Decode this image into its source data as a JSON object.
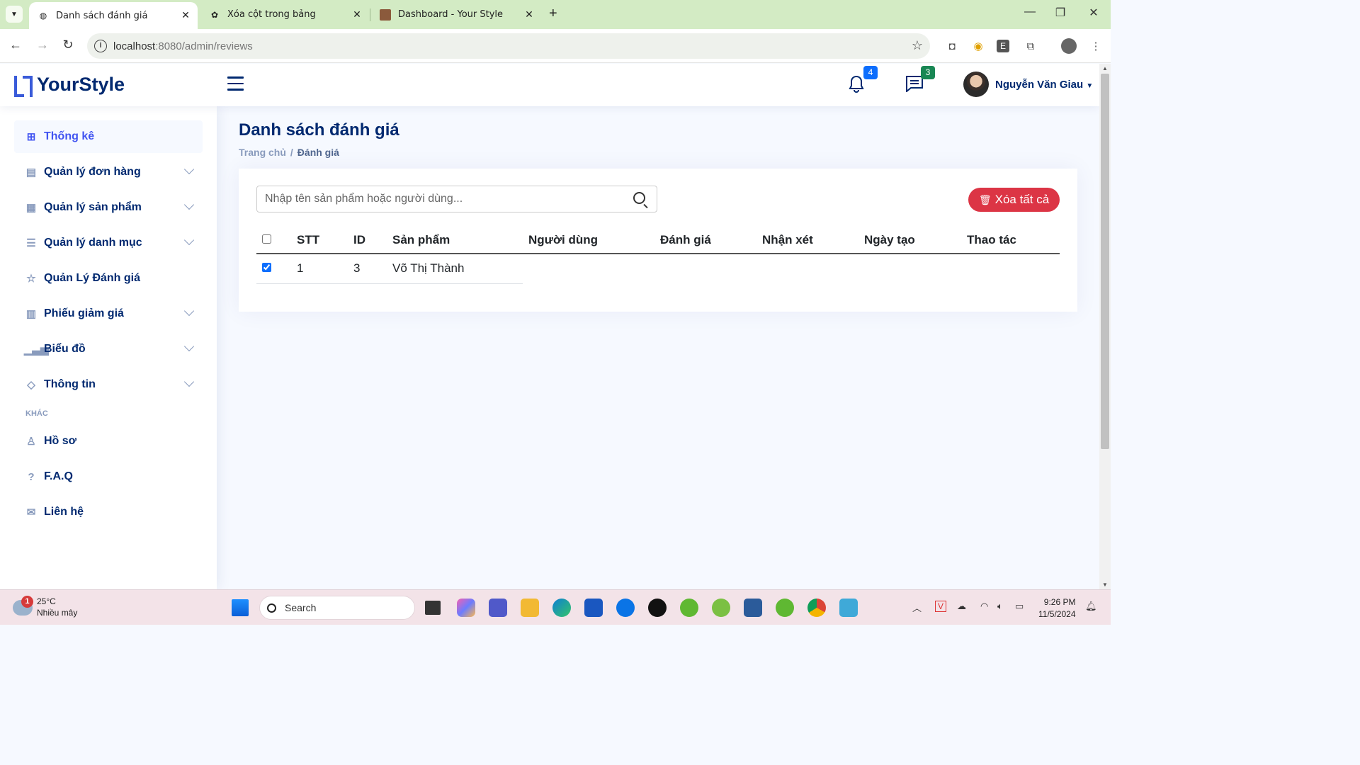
{
  "browser": {
    "tabs": [
      {
        "title": "Danh sách đánh giá",
        "active": true,
        "favicon": "globe-icon"
      },
      {
        "title": "Xóa cột trong bảng",
        "active": false,
        "favicon": "chatgpt-icon"
      },
      {
        "title": "Dashboard - Your Style",
        "active": false,
        "favicon": "image-icon"
      }
    ],
    "url_host": "localhost",
    "url_path": ":8080/admin/reviews"
  },
  "header": {
    "logo": "YourStyle",
    "notifications_count": "4",
    "messages_count": "3",
    "user_name": "Nguyễn Văn Giau"
  },
  "sidebar": {
    "items": [
      {
        "label": "Thống kê",
        "icon": "grid-icon",
        "active": true,
        "expandable": false
      },
      {
        "label": "Quản lý đơn hàng",
        "icon": "server-icon",
        "expandable": true
      },
      {
        "label": "Quản lý sản phẩm",
        "icon": "document-icon",
        "expandable": true
      },
      {
        "label": "Quản lý danh mục",
        "icon": "list-icon",
        "expandable": true
      },
      {
        "label": "Quản Lý Đánh giá",
        "icon": "star-icon",
        "expandable": false
      },
      {
        "label": "Phiếu giảm giá",
        "icon": "voucher-icon",
        "expandable": true
      },
      {
        "label": "Biểu đồ",
        "icon": "bar-chart-icon",
        "expandable": true
      },
      {
        "label": "Thông tin",
        "icon": "gem-icon",
        "expandable": true
      }
    ],
    "section_heading": "KHÁC",
    "other_items": [
      {
        "label": "Hồ sơ",
        "icon": "person-icon"
      },
      {
        "label": "F.A.Q",
        "icon": "question-icon"
      },
      {
        "label": "Liên hệ",
        "icon": "envelope-icon"
      }
    ]
  },
  "main": {
    "title": "Danh sách đánh giá",
    "breadcrumb": [
      "Trang chủ",
      "Đánh giá"
    ],
    "search_placeholder": "Nhập tên sản phẩm hoặc người dùng...",
    "delete_all_label": "Xóa tất cả",
    "table": {
      "columns": [
        "STT",
        "ID",
        "Sản phẩm",
        "Người dùng",
        "Đánh giá",
        "Nhận xét",
        "Ngày tạo",
        "Thao tác"
      ],
      "rows": [
        {
          "checked": true,
          "stt": "1",
          "id": "3",
          "product": "Võ Thị Thành"
        }
      ]
    }
  },
  "taskbar": {
    "weather_badge": "1",
    "temperature": "25°C",
    "condition": "Nhiều mây",
    "search_label": "Search",
    "time": "9:26 PM",
    "date": "11/5/2024"
  },
  "colors": {
    "brand": "#012970",
    "accent": "#4154f1",
    "danger": "#dc3545",
    "notif_badge": "#0d6efd",
    "msg_badge": "#198754"
  }
}
